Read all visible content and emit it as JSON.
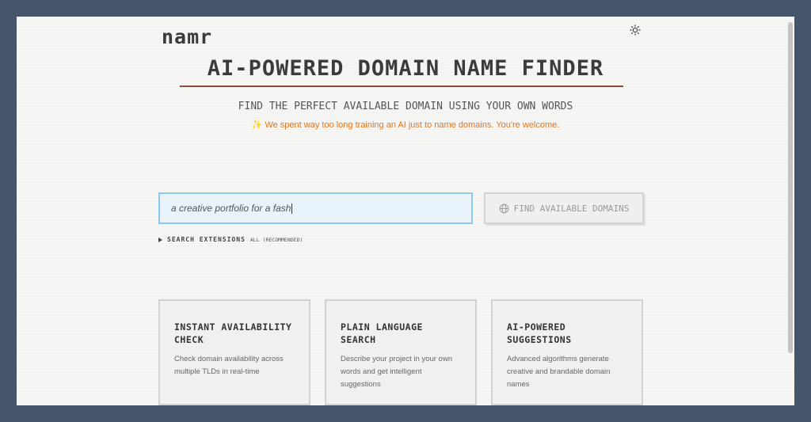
{
  "header": {
    "logo": "namr",
    "theme_toggle_icon": "sun-icon"
  },
  "hero": {
    "title": "AI-POWERED DOMAIN NAME FINDER",
    "subtitle": "FIND THE PERFECT AVAILABLE DOMAIN USING YOUR OWN WORDS",
    "tagline_icon": "sparkles-icon",
    "tagline_emoji": "✨",
    "tagline": "We spent way too long training an AI just to name domains. You're welcome."
  },
  "search": {
    "value": "a creative portfolio for a fash",
    "button_icon": "globe-icon",
    "button_label": "FIND AVAILABLE DOMAINS",
    "extensions_label": "SEARCH EXTENSIONS",
    "extensions_value": "ALL (RECOMMENDED)"
  },
  "features": [
    {
      "title": "INSTANT AVAILABILITY\nCHECK",
      "description": "Check domain availability across multiple TLDs in real-time"
    },
    {
      "title": "PLAIN LANGUAGE\nSEARCH",
      "description": "Describe your project in your own words and get intelligent suggestions"
    },
    {
      "title": "AI-POWERED\nSUGGESTIONS",
      "description": "Advanced algorithms generate creative and brandable domain names"
    }
  ],
  "colors": {
    "page_background": "#43546b",
    "accent_rule": "#8d4a3a",
    "tagline": "#e4751e",
    "input_border": "#8ec8ef"
  }
}
